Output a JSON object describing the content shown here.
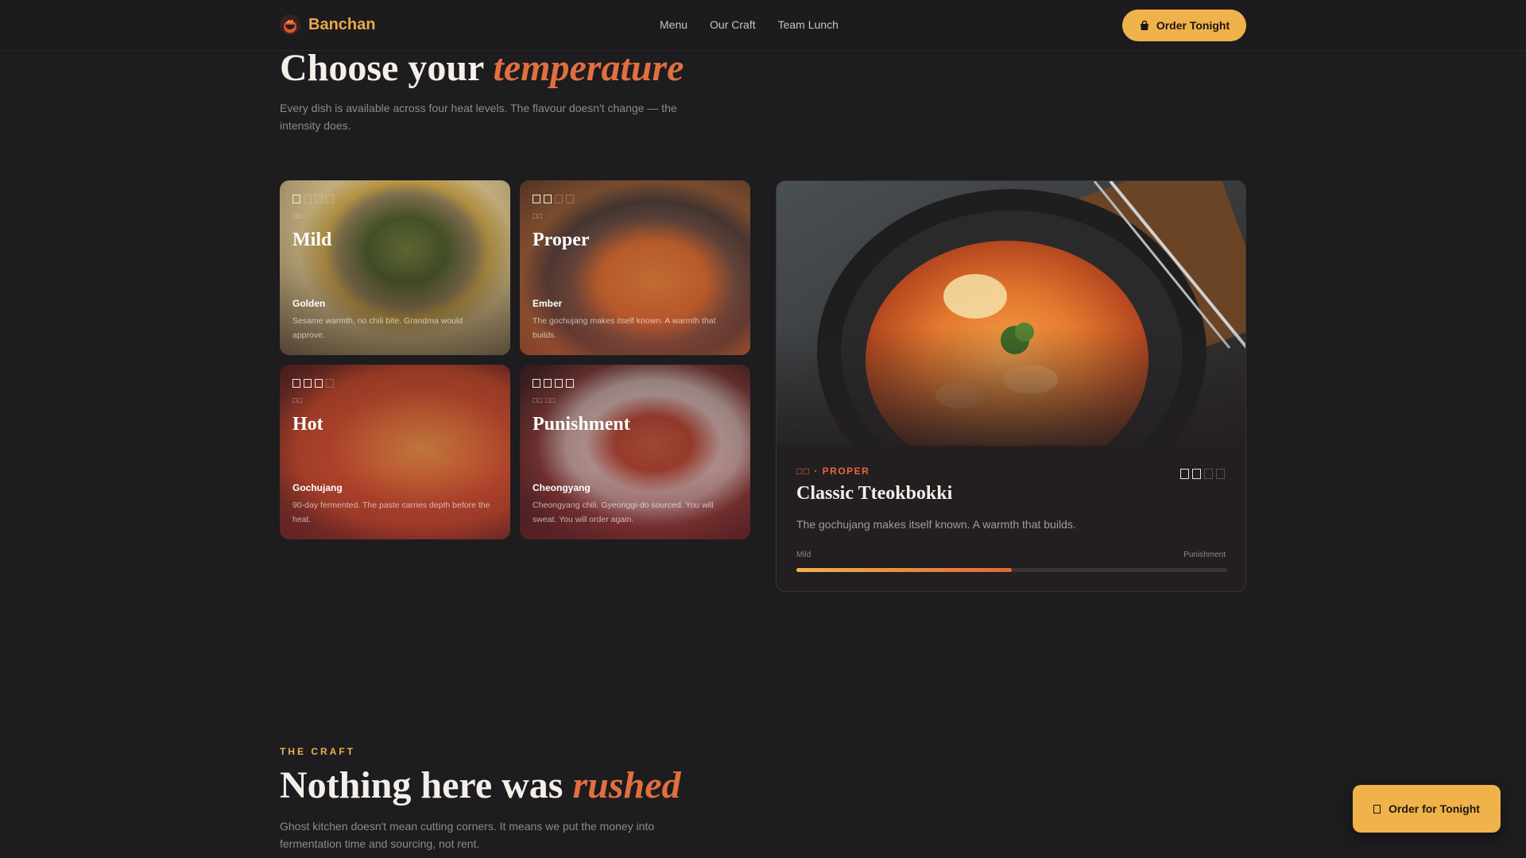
{
  "nav": {
    "brand": "Banchan",
    "links": [
      "Menu",
      "Our Craft",
      "Team Lunch"
    ],
    "cta": "Order Tonight"
  },
  "hero": {
    "title_prefix": "Choose your",
    "title_accent": "temperature",
    "subtitle": "Every dish is available across four heat levels. The flavour doesn't change — the intensity does."
  },
  "levels": [
    {
      "name": "Mild",
      "chili": "Golden",
      "description": "Sesame warmth, no chili bite. Grandma would approve.",
      "heat": 1,
      "korean": "□□",
      "selected": false
    },
    {
      "name": "Proper",
      "chili": "Ember",
      "description": "The gochujang makes itself known. A warmth that builds.",
      "heat": 2,
      "korean": "□□",
      "selected": true
    },
    {
      "name": "Hot",
      "chili": "Gochujang",
      "description": "90-day fermented. The paste carries depth before the heat.",
      "heat": 3,
      "korean": "□□",
      "selected": false
    },
    {
      "name": "Punishment",
      "chili": "Cheongyang",
      "description": "Cheongyang chili. Gyeonggi-do sourced. You will sweat. You will order again.",
      "heat": 4,
      "korean": "□□ □□",
      "selected": false
    }
  ],
  "detail": {
    "tag": "□□ · PROPER",
    "title": "Classic Tteokbokki",
    "description": "The gochujang makes itself known. A warmth that builds.",
    "heat": 2,
    "scale_min": "Mild",
    "scale_max": "Punishment",
    "heat_fraction": 0.5
  },
  "craft": {
    "eyebrow": "THE CRAFT",
    "title_prefix": "Nothing here was",
    "title_accent": "rushed",
    "subtitle": "Ghost kitchen doesn't mean cutting corners. It means we put the money into fermentation time and sourcing, not rent."
  },
  "float_cta": "Order for Tonight",
  "colors": {
    "accent": "#e0683a",
    "gold": "#f0b24a",
    "background": "#1d1c1f"
  }
}
